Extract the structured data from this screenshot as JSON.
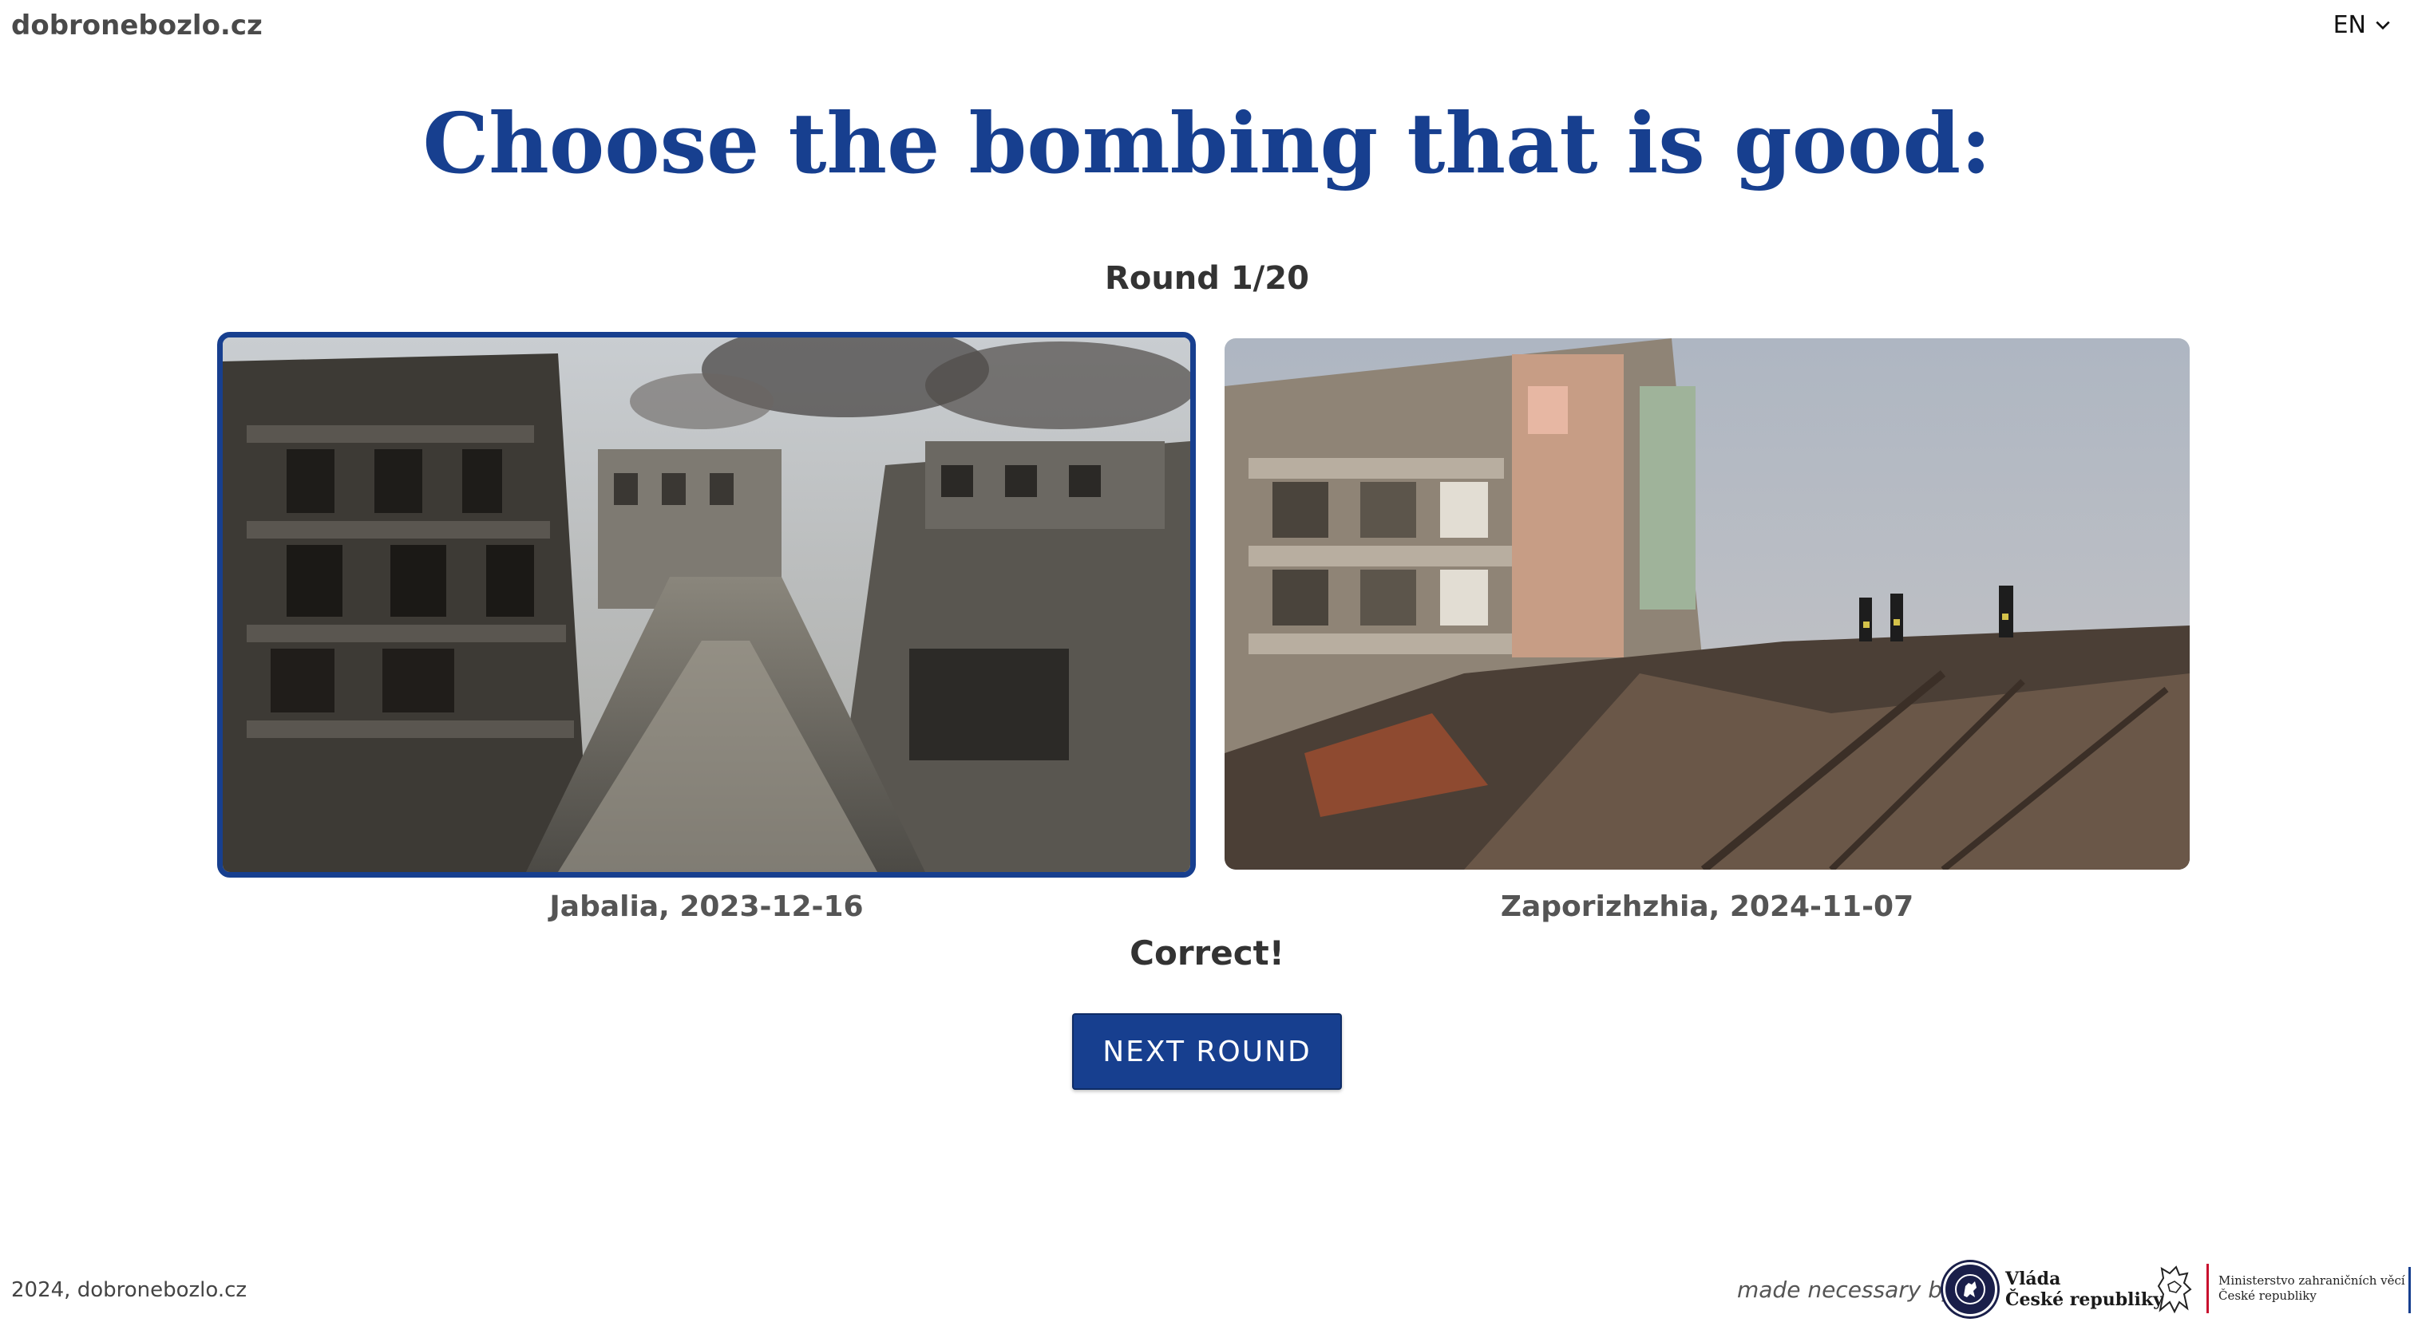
{
  "header": {
    "site_name": "dobronebozlo.cz",
    "language": {
      "selected": "EN",
      "icon": "chevron-down-icon"
    }
  },
  "main": {
    "title": "Choose the bombing that is good:",
    "round": "Round 1/20",
    "options": [
      {
        "caption": "Jabalia, 2023-12-16",
        "selected": true
      },
      {
        "caption": "Zaporizhzhia, 2024-11-07",
        "selected": false
      }
    ],
    "result": "Correct!",
    "next_button": "NEXT ROUND"
  },
  "footer": {
    "copyright": "2024, dobronebozlo.cz",
    "made_by": "made necessary by",
    "logos": [
      {
        "line1": "Vláda",
        "line2": "České republiky"
      },
      {
        "line1": "Ministerstvo zahraničních věcí",
        "line2": "České republiky"
      }
    ]
  },
  "colors": {
    "accent": "#173f8f",
    "text": "#333333",
    "caption": "#555555"
  }
}
